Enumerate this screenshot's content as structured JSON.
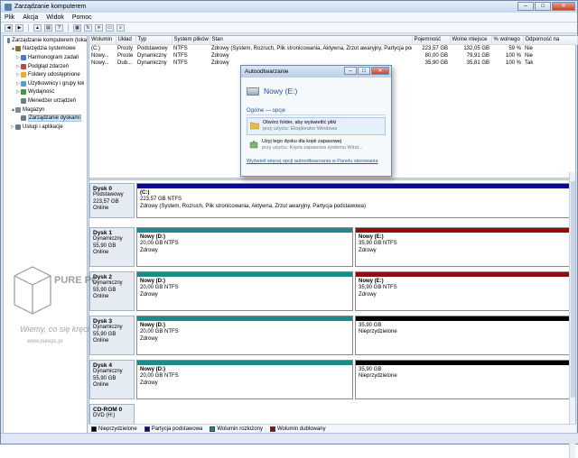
{
  "window": {
    "title": "Zarządzanie komputerem",
    "controls": {
      "minimize": "–",
      "maximize": "□",
      "close": "✕"
    }
  },
  "menu": [
    "Plik",
    "Akcja",
    "Widok",
    "Pomoc"
  ],
  "tree": [
    {
      "label": "Zarządzanie komputerem (loka",
      "indent": 0,
      "expander": "",
      "icon": "computer-management-icon",
      "color": "#5a7fb0"
    },
    {
      "label": "Narzędzia systemowe",
      "indent": 1,
      "expander": "▲",
      "icon": "tools-icon",
      "color": "#8a6d3b"
    },
    {
      "label": "Harmonogram zadań",
      "indent": 2,
      "expander": "▷",
      "icon": "clock-icon",
      "color": "#3a7fd1"
    },
    {
      "label": "Podgląd zdarzeń",
      "indent": 2,
      "expander": "▷",
      "icon": "event-viewer-icon",
      "color": "#b94a48"
    },
    {
      "label": "Foldery udostępnione",
      "indent": 2,
      "expander": "▷",
      "icon": "shared-folder-icon",
      "color": "#e1b12c"
    },
    {
      "label": "Użytkownicy i grupy lok",
      "indent": 2,
      "expander": "▷",
      "icon": "users-icon",
      "color": "#5b9bd5"
    },
    {
      "label": "Wydajność",
      "indent": 2,
      "expander": "▷",
      "icon": "performance-icon",
      "color": "#3c9a3c"
    },
    {
      "label": "Menedżer urządzeń",
      "indent": 2,
      "expander": "",
      "icon": "device-manager-icon",
      "color": "#6a7b8c"
    },
    {
      "label": "Magazyn",
      "indent": 1,
      "expander": "▲",
      "icon": "storage-icon",
      "color": "#7d8a99"
    },
    {
      "label": "Zarządzanie dyskami",
      "indent": 2,
      "expander": "",
      "icon": "disk-management-icon",
      "color": "#6a7b8c",
      "selected": true
    },
    {
      "label": "Usługi i aplikacje",
      "indent": 1,
      "expander": "▷",
      "icon": "services-icon",
      "color": "#6a7b8c"
    }
  ],
  "volume_table": {
    "headers": [
      "Wolumin",
      "Układ",
      "Typ",
      "System plików",
      "Stan",
      "Pojemność",
      "Wolne miejsce",
      "% wolnego",
      "Odporność na"
    ],
    "rows": [
      [
        "(C:)",
        "Prosty",
        "Podstawowy",
        "NTFS",
        "Zdrowy (System, Rozruch, Plik stronicowania, Aktywna, Zrzut awaryjny, Partycja podstawowa)",
        "223,57 GB",
        "132,05 GB",
        "59 %",
        "Nie"
      ],
      [
        "Nowy...",
        "Proste",
        "Dynamiczny",
        "NTFS",
        "Zdrowy",
        "80,00 GB",
        "79,91 GB",
        "100 %",
        "Nie"
      ],
      [
        "Nowy...",
        "Dub...",
        "Dynamiczny",
        "NTFS",
        "Zdrowy",
        "35,90 GB",
        "35,81 GB",
        "100 %",
        "Tak"
      ]
    ]
  },
  "disks": [
    {
      "name": "Dysk 0",
      "type": "Podstawowy",
      "size": "223,57 GB",
      "status": "Online",
      "partitions": [
        {
          "name": "(C:)",
          "size": "223,57 GB NTFS",
          "status": "Zdrowy (System, Rozruch, Plik stronicowania, Aktywna, Zrzut awaryjny, Partycja podstawowa)",
          "color": "#0a0a8c",
          "share": 1
        }
      ]
    },
    {
      "name": "Dysk 1",
      "type": "Dynamiczny",
      "size": "55,90 GB",
      "status": "Online",
      "partitions": [
        {
          "name": "Nowy  (D:)",
          "size": "20,00 GB NTFS",
          "status": "Zdrowy",
          "color": "#1a8a8a",
          "share": 0.5
        },
        {
          "name": "Nowy  (E:)",
          "size": "35,90 GB NTFS",
          "status": "Zdrowy",
          "color": "#8c1010",
          "share": 0.5
        }
      ]
    },
    {
      "name": "Dysk 2",
      "type": "Dynamiczny",
      "size": "55,90 GB",
      "status": "Online",
      "partitions": [
        {
          "name": "Nowy  (D:)",
          "size": "20,00 GB NTFS",
          "status": "Zdrowy",
          "color": "#1a8a8a",
          "share": 0.5
        },
        {
          "name": "Nowy  (E:)",
          "size": "35,90 GB NTFS",
          "status": "Zdrowy",
          "color": "#8c1010",
          "share": 0.5
        }
      ]
    },
    {
      "name": "Dysk 3",
      "type": "Dynamiczny",
      "size": "55,90 GB",
      "status": "Online",
      "partitions": [
        {
          "name": "Nowy  (D:)",
          "size": "20,00 GB NTFS",
          "status": "Zdrowy",
          "color": "#1a8a8a",
          "share": 0.5
        },
        {
          "name": "",
          "size": "35,90 GB",
          "status": "Nieprzydzielone",
          "color": "#000000",
          "share": 0.5
        }
      ]
    },
    {
      "name": "Dysk 4",
      "type": "Dynamiczny",
      "size": "55,90 GB",
      "status": "Online",
      "partitions": [
        {
          "name": "Nowy  (D:)",
          "size": "20,00 GB NTFS",
          "status": "Zdrowy",
          "color": "#1a8a8a",
          "share": 0.5
        },
        {
          "name": "",
          "size": "35,90 GB",
          "status": "Nieprzydzielone",
          "color": "#000000",
          "share": 0.5
        }
      ]
    },
    {
      "name": "CD-ROM 0",
      "type": "DVD (H:)",
      "size": "",
      "status": "",
      "partitions": []
    }
  ],
  "legend": [
    {
      "label": "Nieprzydzielone",
      "color": "#000000"
    },
    {
      "label": "Partycja podstawowa",
      "color": "#0a0a8c"
    },
    {
      "label": "Wolumin rozłożony",
      "color": "#1a8a8a"
    },
    {
      "label": "Wolumin dublowany",
      "color": "#8c1010"
    }
  ],
  "autoplay": {
    "title": "Autoodtwarzanie",
    "drive": "Nowy (E:)",
    "group": "Ogólne — opcje",
    "options": [
      {
        "main": "Otwórz folder, aby wyświetlić pliki",
        "sub": "przy użyciu: Eksplorator Windows",
        "icon": "folder-icon"
      },
      {
        "main": "Użyj tego dysku dla kopii zapasowej",
        "sub": "przy użyciu: Kopia zapasowa systemu Wind...",
        "icon": "backup-icon"
      }
    ],
    "link": "Wyświetl więcej opcji autoodtwarzania w Panelu sterowania"
  },
  "watermark": {
    "brand": "PURE PC",
    "tagline": "Wiemy, co się kręci",
    "url": "www.purepc.pl"
  }
}
